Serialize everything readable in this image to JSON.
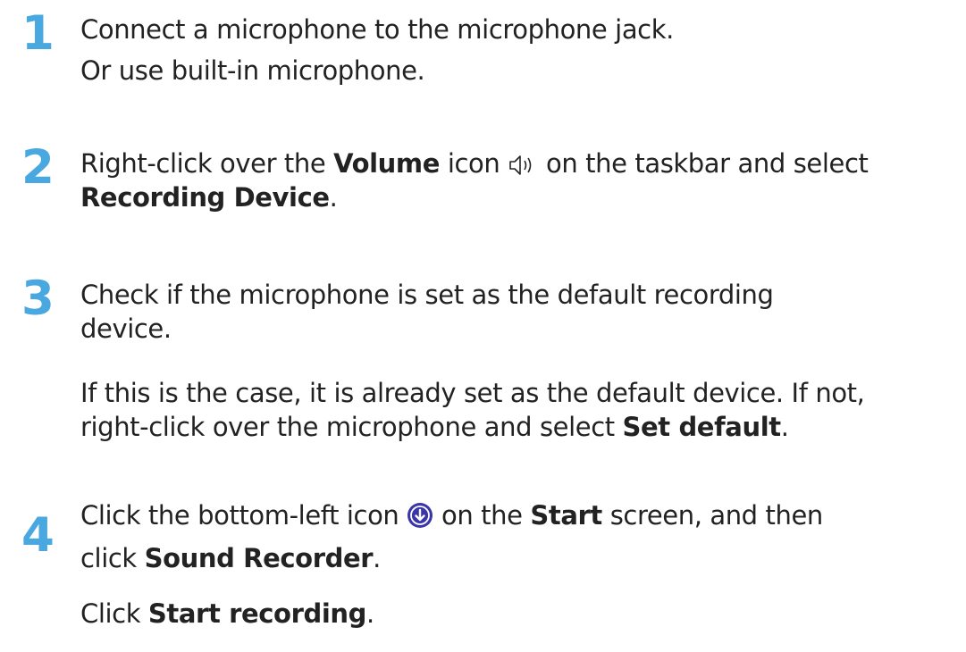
{
  "steps": [
    {
      "number": "1",
      "lines": [
        {
          "text": "Connect a microphone to the microphone jack."
        },
        {
          "text": "Or use built-in microphone."
        }
      ]
    },
    {
      "number": "2",
      "line1_a": "Right-click over the ",
      "line1_bold": "Volume",
      "line1_b": " icon ",
      "line1_c": " on the taskbar and select",
      "line2_bold": "Recording Device",
      "line2_tail": "."
    },
    {
      "number": "3",
      "line1": "Check if the microphone is set as the default recording",
      "line2": "device.",
      "line3": "If this is the case, it is already set as the default device. If not,",
      "line4_a": "right-click over the microphone and select ",
      "line4_bold": "Set default",
      "line4_tail": "."
    },
    {
      "number": "4",
      "line1_a": "Click the bottom-left icon ",
      "line1_b": " on the ",
      "line1_bold": "Start",
      "line1_c": " screen, and then",
      "line2_a": "click ",
      "line2_bold": "Sound Recorder",
      "line2_tail": ".",
      "line3_a": "Click ",
      "line3_bold": "Start recording",
      "line3_tail": "."
    }
  ],
  "icons": {
    "volume": "speaker-icon",
    "apps": "down-arrow-circle-icon"
  },
  "colors": {
    "step_number": "#4aa8e0",
    "text": "#222222",
    "apps_icon_bg": "#3a35a8"
  }
}
